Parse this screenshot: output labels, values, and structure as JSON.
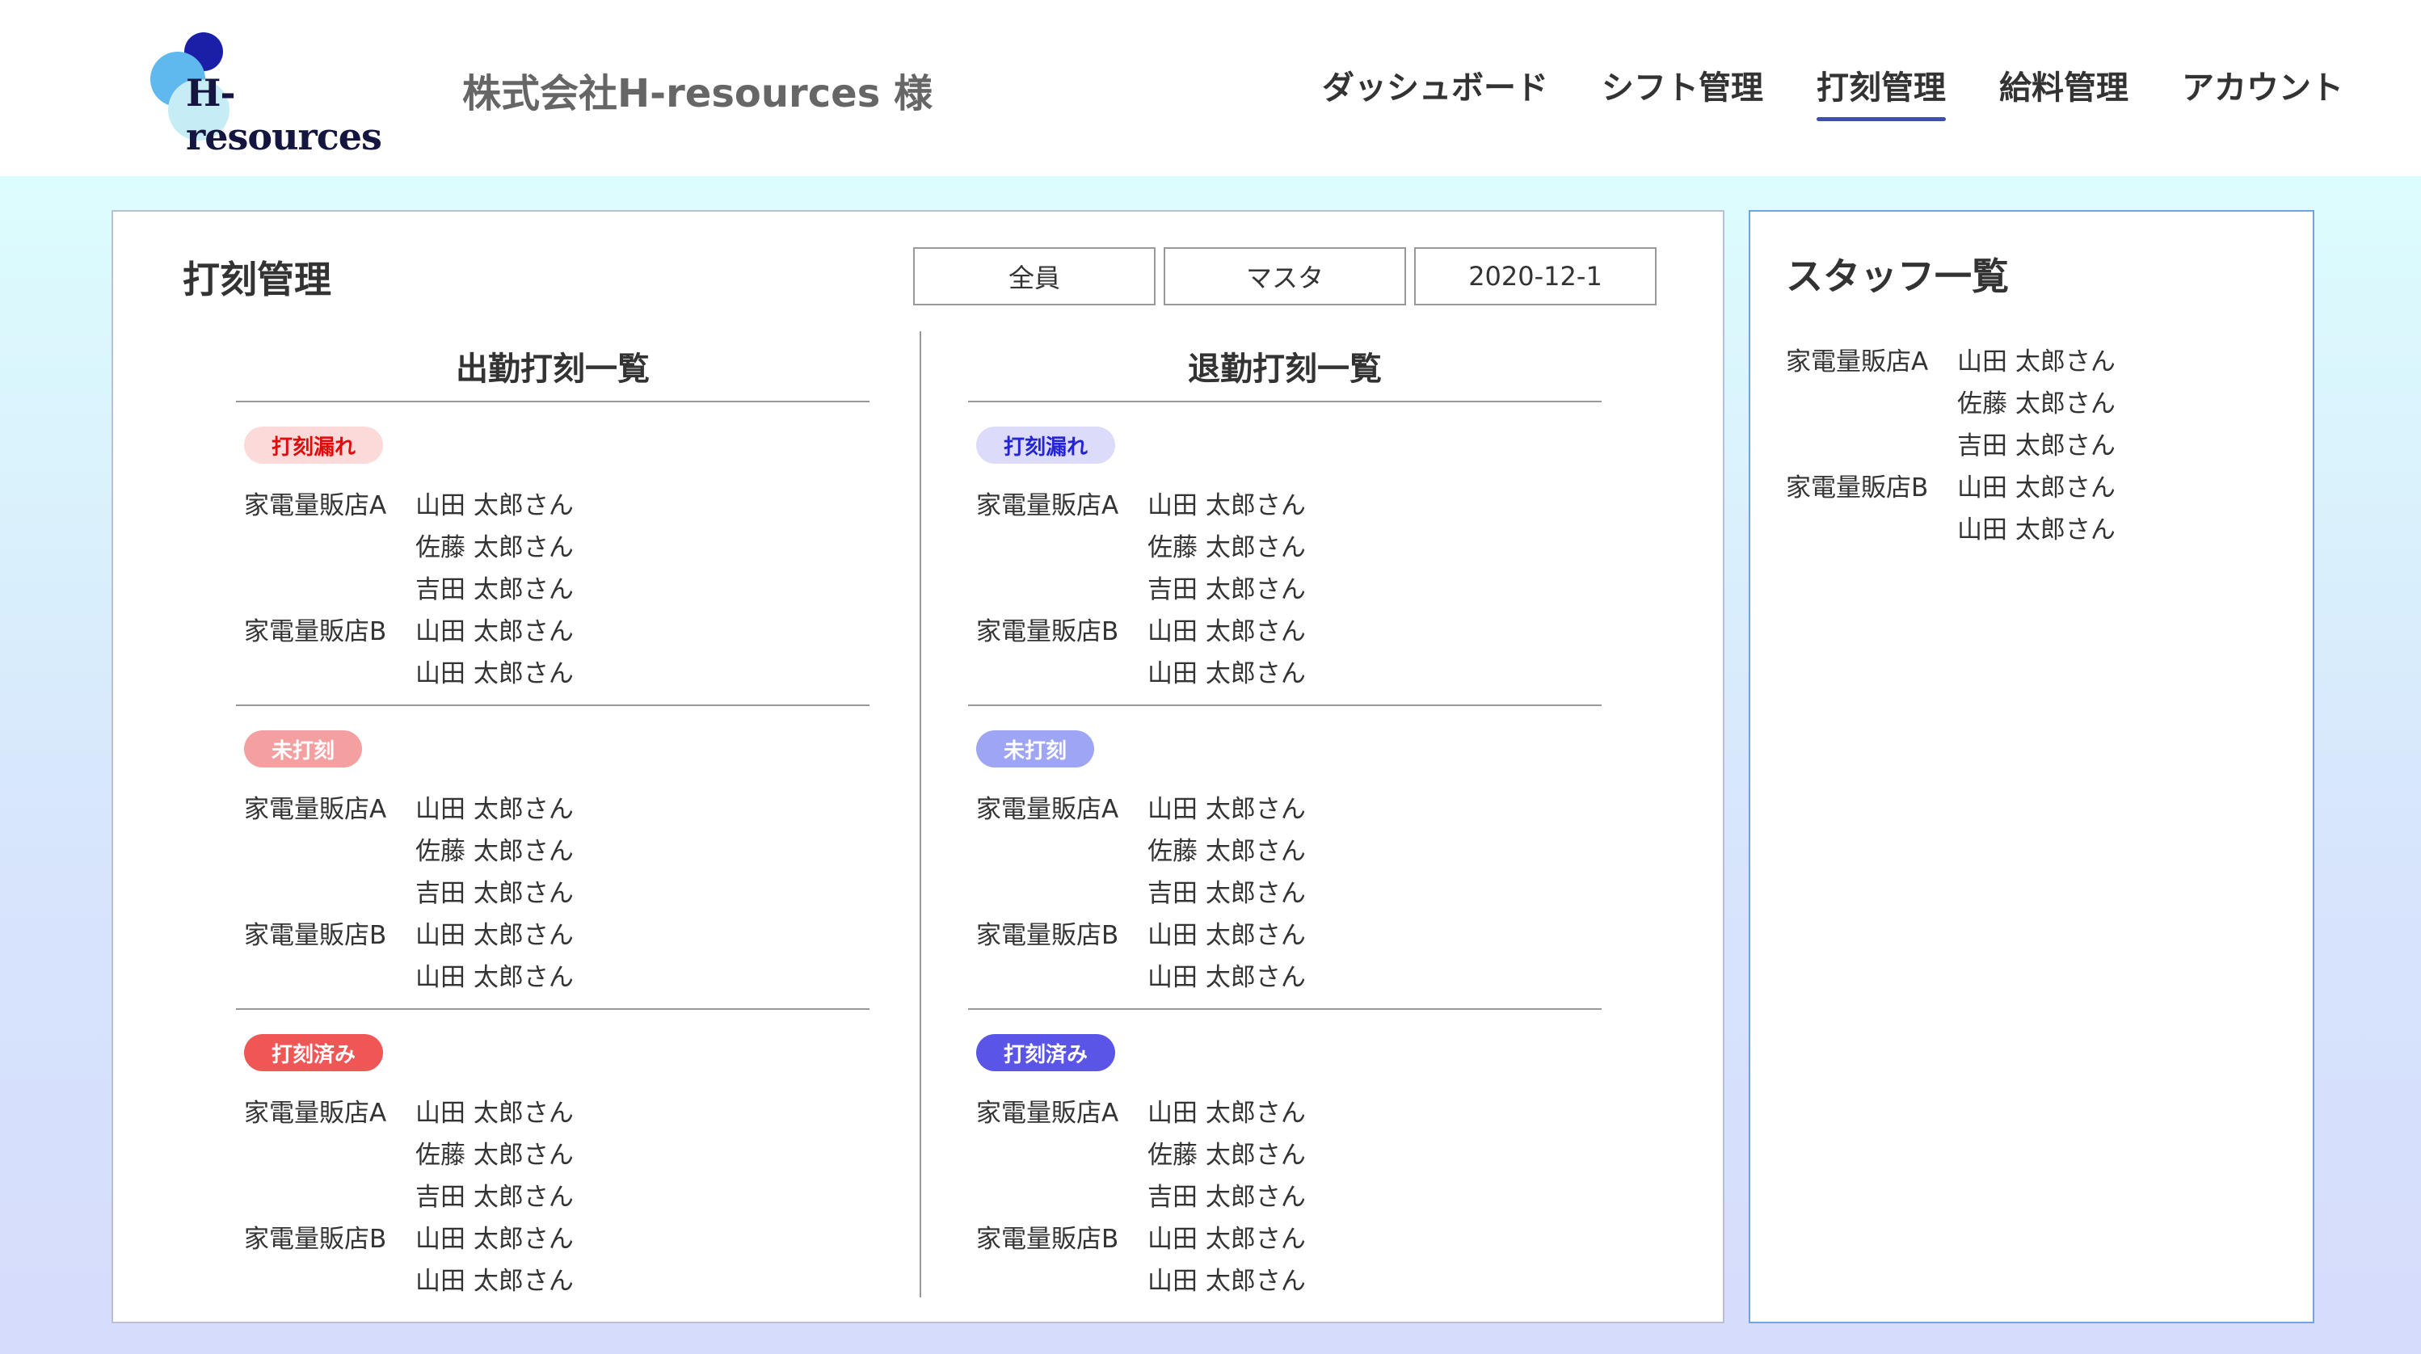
{
  "header": {
    "logo_text": "H-resources",
    "company": "株式会社H-resources 様",
    "nav": [
      {
        "label": "ダッシュボード",
        "active": false
      },
      {
        "label": "シフト管理",
        "active": false
      },
      {
        "label": "打刻管理",
        "active": true
      },
      {
        "label": "給料管理",
        "active": false
      },
      {
        "label": "アカウント",
        "active": false
      }
    ]
  },
  "main": {
    "title": "打刻管理",
    "filters": [
      "全員",
      "マスタ",
      "2020-12-1"
    ],
    "columns": [
      {
        "title": "出勤打刻一覧",
        "sections": [
          {
            "badge": "打刻漏れ",
            "badge_bg": "#fcdada",
            "badge_fg": "#e00b0b",
            "rows": [
              {
                "store": "家電量販店A",
                "person": "山田 太郎さん"
              },
              {
                "store": "",
                "person": "佐藤 太郎さん"
              },
              {
                "store": "",
                "person": "吉田 太郎さん"
              },
              {
                "store": "家電量販店B",
                "person": "山田 太郎さん"
              },
              {
                "store": "",
                "person": "山田 太郎さん"
              }
            ]
          },
          {
            "badge": "未打刻",
            "badge_bg": "#f4a0a0",
            "badge_fg": "#ffffff",
            "rows": [
              {
                "store": "家電量販店A",
                "person": "山田 太郎さん"
              },
              {
                "store": "",
                "person": "佐藤 太郎さん"
              },
              {
                "store": "",
                "person": "吉田 太郎さん"
              },
              {
                "store": "家電量販店B",
                "person": "山田 太郎さん"
              },
              {
                "store": "",
                "person": "山田 太郎さん"
              }
            ]
          },
          {
            "badge": "打刻済み",
            "badge_bg": "#ef5757",
            "badge_fg": "#ffffff",
            "rows": [
              {
                "store": "家電量販店A",
                "person": "山田 太郎さん"
              },
              {
                "store": "",
                "person": "佐藤 太郎さん"
              },
              {
                "store": "",
                "person": "吉田 太郎さん"
              },
              {
                "store": "家電量販店B",
                "person": "山田 太郎さん"
              },
              {
                "store": "",
                "person": "山田 太郎さん"
              }
            ]
          }
        ]
      },
      {
        "title": "退勤打刻一覧",
        "sections": [
          {
            "badge": "打刻漏れ",
            "badge_bg": "#dcdcfa",
            "badge_fg": "#2424d4",
            "rows": [
              {
                "store": "家電量販店A",
                "person": "山田 太郎さん"
              },
              {
                "store": "",
                "person": "佐藤 太郎さん"
              },
              {
                "store": "",
                "person": "吉田 太郎さん"
              },
              {
                "store": "家電量販店B",
                "person": "山田 太郎さん"
              },
              {
                "store": "",
                "person": "山田 太郎さん"
              }
            ]
          },
          {
            "badge": "未打刻",
            "badge_bg": "#9ea5f3",
            "badge_fg": "#ffffff",
            "rows": [
              {
                "store": "家電量販店A",
                "person": "山田 太郎さん"
              },
              {
                "store": "",
                "person": "佐藤 太郎さん"
              },
              {
                "store": "",
                "person": "吉田 太郎さん"
              },
              {
                "store": "家電量販店B",
                "person": "山田 太郎さん"
              },
              {
                "store": "",
                "person": "山田 太郎さん"
              }
            ]
          },
          {
            "badge": "打刻済み",
            "badge_bg": "#5a55e6",
            "badge_fg": "#ffffff",
            "rows": [
              {
                "store": "家電量販店A",
                "person": "山田 太郎さん"
              },
              {
                "store": "",
                "person": "佐藤 太郎さん"
              },
              {
                "store": "",
                "person": "吉田 太郎さん"
              },
              {
                "store": "家電量販店B",
                "person": "山田 太郎さん"
              },
              {
                "store": "",
                "person": "山田 太郎さん"
              }
            ]
          }
        ]
      }
    ]
  },
  "staff": {
    "title": "スタッフ一覧",
    "rows": [
      {
        "store": "家電量販店A",
        "person": "山田 太郎さん"
      },
      {
        "store": "",
        "person": "佐藤 太郎さん"
      },
      {
        "store": "",
        "person": "吉田 太郎さん"
      },
      {
        "store": "家電量販店B",
        "person": "山田 太郎さん"
      },
      {
        "store": "",
        "person": "山田 太郎さん"
      }
    ]
  }
}
